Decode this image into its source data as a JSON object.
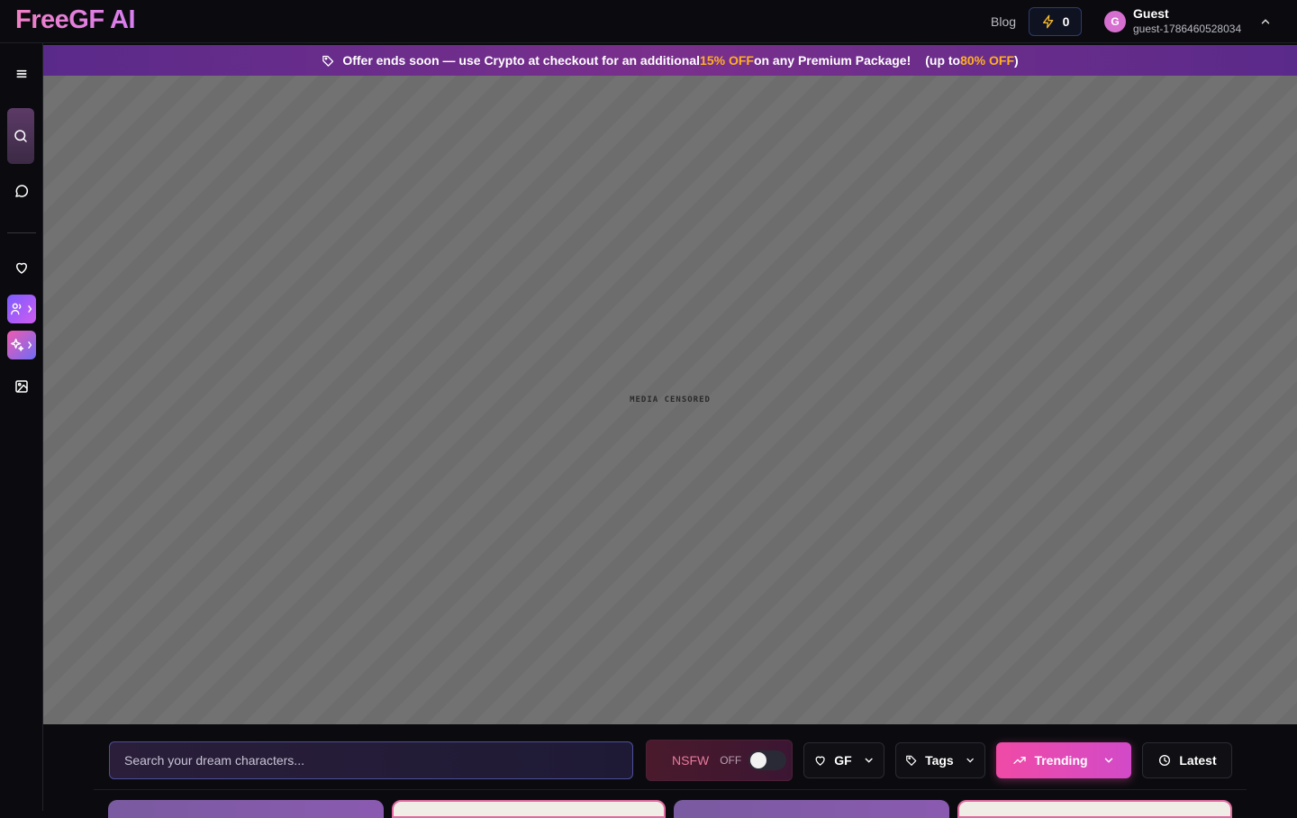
{
  "header": {
    "logo": "FreeGF AI",
    "blog": "Blog",
    "credits": "0",
    "user": {
      "avatar_initial": "G",
      "name": "Guest",
      "id": "guest-1786460528034"
    }
  },
  "promo": {
    "text_a": "Offer ends soon — use Crypto at checkout for an additional ",
    "highlight_a": "15% OFF",
    "text_b": " on any Premium Package!",
    "text_c": "(up to ",
    "highlight_b": "80% OFF",
    "text_d": ")"
  },
  "media": {
    "label": "MEDIA CENSORED"
  },
  "filters": {
    "search_placeholder": "Search your dream characters...",
    "nsfw_label": "NSFW",
    "nsfw_state": "OFF",
    "gf_label": "GF",
    "tags_label": "Tags",
    "trending_label": "Trending",
    "latest_label": "Latest"
  },
  "icons": {
    "menu": "menu-icon",
    "search": "search-icon",
    "chat": "chat-icon",
    "heart": "heart-icon",
    "users": "users-icon",
    "sparkle": "sparkle-icon",
    "image": "image-icon"
  },
  "colors": {
    "accent_pink": "#f04aa6",
    "promo_purple": "#6a2d8a",
    "highlight_orange": "#ffb020"
  }
}
